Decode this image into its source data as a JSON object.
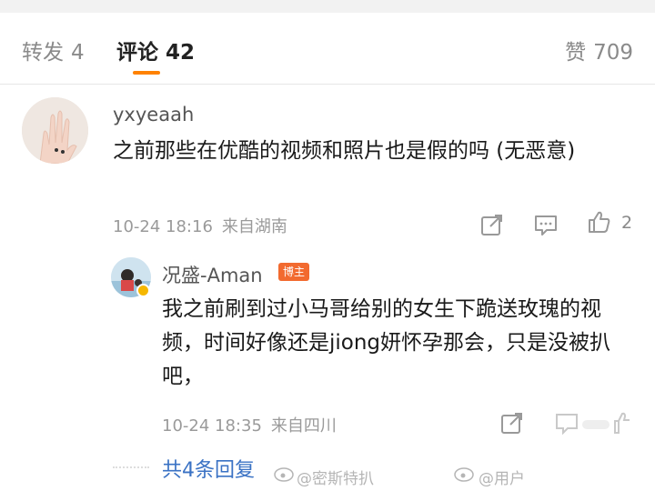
{
  "tabs": {
    "repost_label": "转发",
    "repost_count": "4",
    "comment_label": "评论",
    "comment_count": "42",
    "like_label": "赞",
    "like_count": "709"
  },
  "comments": [
    {
      "username": "yxyeaah",
      "text": "之前那些在优酷的视频和照片也是假的吗 (无恶意)",
      "date": "10-24 18:16",
      "location": "来自湖南",
      "like_count": "2"
    }
  ],
  "reply": {
    "username": "况盛-Aman",
    "badge": "博主",
    "text": "我之前刷到过小马哥给别的女生下跪送玫瑰的视频，时间好像还是jiong妍怀孕那会，只是没被扒吧，",
    "date": "10-24 18:35",
    "location": "来自四川"
  },
  "more_replies": "共4条回复",
  "watermarks": [
    "@密斯特扒",
    "@用户"
  ],
  "icons": [
    "share-icon",
    "comment-icon",
    "like-icon",
    "verified-badge-icon",
    "chevron-right-icon"
  ],
  "colors": {
    "accent": "#ff8200",
    "link": "#3a72c4",
    "badge": "#f26a2f",
    "verified": "#f5b700"
  }
}
